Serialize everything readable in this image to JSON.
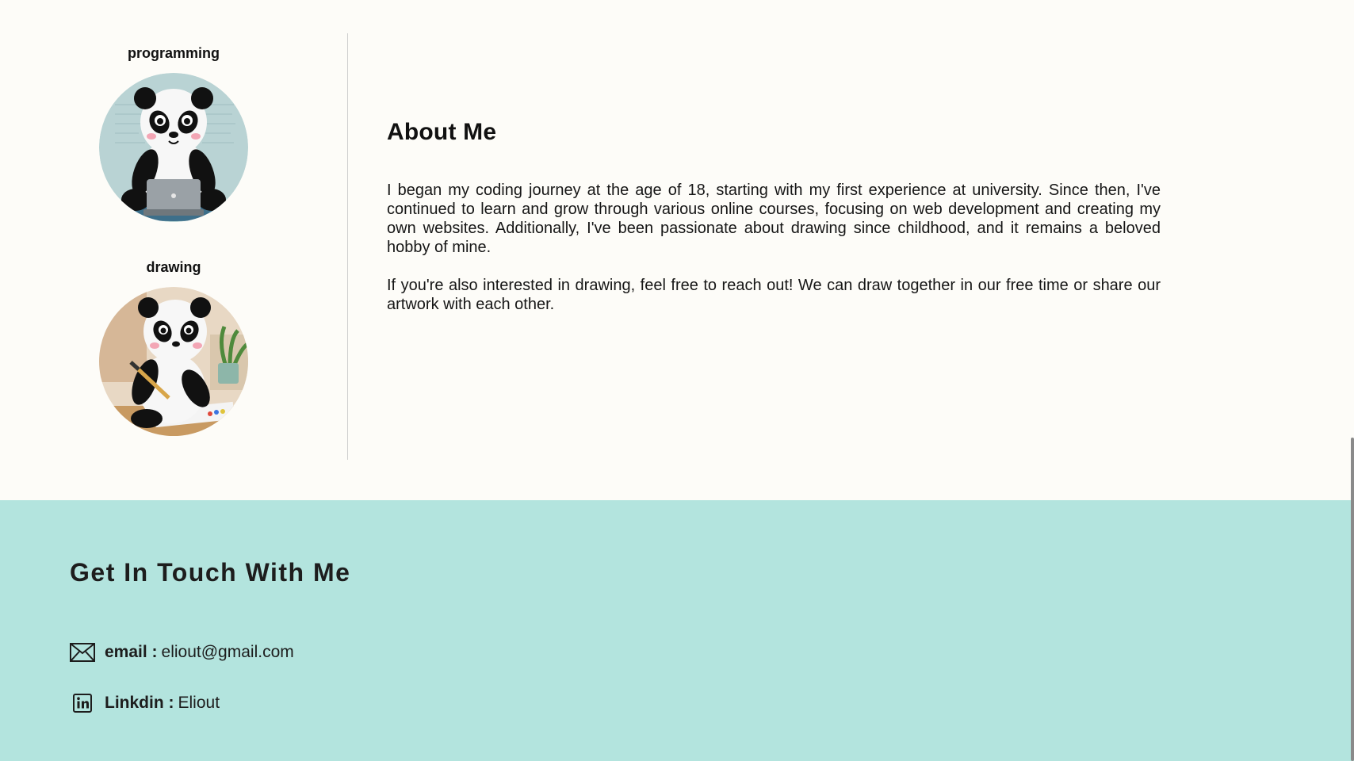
{
  "hobbies": [
    {
      "title": "programming",
      "image": "panda-with-laptop"
    },
    {
      "title": "drawing",
      "image": "panda-drawing"
    }
  ],
  "about": {
    "heading": "About Me",
    "paragraphs": [
      "I began my coding journey at the age of 18, starting with my first experience at university. Since then, I've continued to learn and grow through various online courses, focusing on web development and creating my own websites. Additionally, I've been passionate about drawing since childhood, and it remains a beloved hobby of mine.",
      "If you're also interested in drawing, feel free to reach out! We can draw together in our free time or share our artwork with each other."
    ]
  },
  "contact": {
    "heading": "Get In Touch With Me",
    "items": [
      {
        "icon": "envelope-icon",
        "label": "email :",
        "value": "eliout@gmail.com"
      },
      {
        "icon": "linkedin-icon",
        "label": "Linkdin :",
        "value": "Eliout"
      }
    ]
  },
  "colors": {
    "page_bg": "#fdfcf8",
    "contact_bg": "#b3e4de",
    "text": "#111111"
  }
}
